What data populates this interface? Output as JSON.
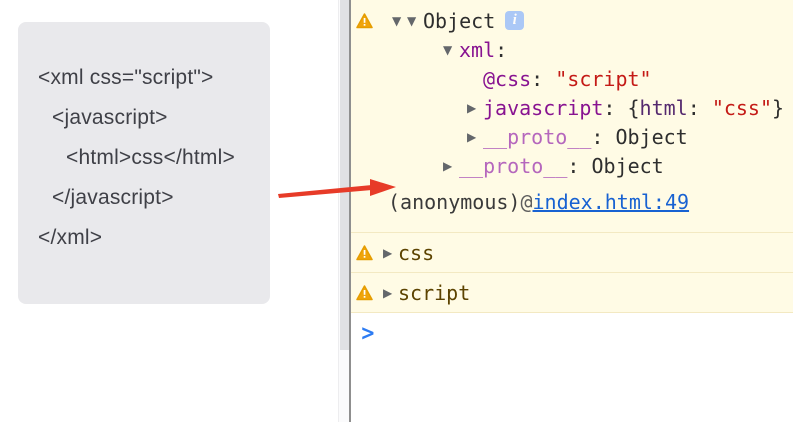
{
  "code_card": {
    "lines": [
      "<xml css=\"script\">",
      "<javascript>",
      "<html>css</html>",
      "</javascript>",
      "</xml>"
    ]
  },
  "console": {
    "object_row": {
      "label": "Object"
    },
    "tree": {
      "xml": {
        "name": "xml",
        "colon": ":"
      },
      "attr": {
        "name": "@css",
        "colon": ": ",
        "value": "\"script\""
      },
      "js": {
        "name": "javascript",
        "open": ": {",
        "key": "html",
        "sep": ": ",
        "value": "\"css\"",
        "close": "}"
      },
      "proto1": {
        "name": "__proto__",
        "colon": ": ",
        "value": "Object"
      },
      "proto2": {
        "name": "__proto__",
        "colon": ": ",
        "value": "Object"
      }
    },
    "stack": {
      "fn": "(anonymous)",
      "sep": " @ ",
      "link": "index.html:49"
    },
    "warnings": [
      {
        "label": "css"
      },
      {
        "label": "script"
      }
    ],
    "prompt": {
      "glyph": ">"
    }
  },
  "icons": {
    "expand_open": "▼",
    "expand_closed": "▶",
    "info": "i"
  },
  "colors": {
    "warning_background": "#fffbe5",
    "warning_border": "#f3e9c2",
    "warning_text": "#5c4300",
    "warning_icon": "#f0a40b",
    "property_purple": "#881391",
    "proto_purple": "#b567bd",
    "string_red": "#c41a16",
    "link_blue": "#1862d2",
    "prompt_blue": "#2d7cf3",
    "info_badge_blue": "#abc8f6",
    "arrow_red": "#e73b28",
    "code_card_background": "#e9e9ec",
    "divider_gray": "#8f8f8f"
  }
}
